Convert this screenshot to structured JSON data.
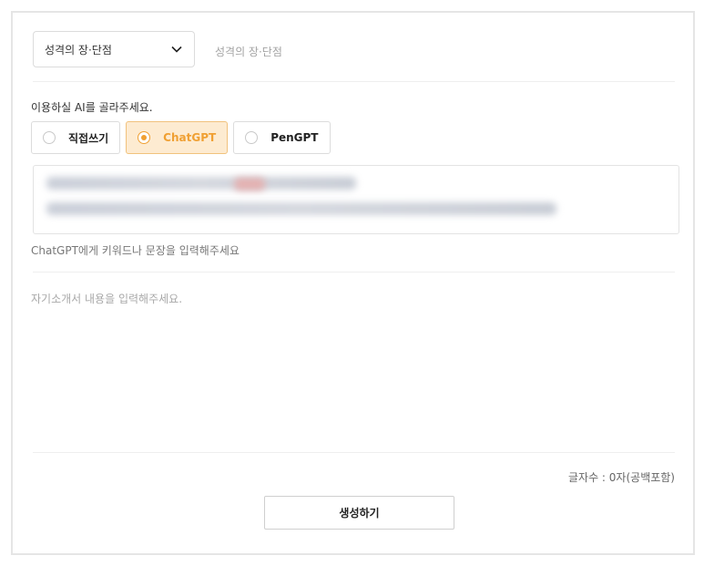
{
  "topic": {
    "select_value": "성격의 장·단점",
    "hint": "성격의 장·단점",
    "chevron_icon": "chevron-down-icon"
  },
  "ai": {
    "label": "이용하실 AI를 골라주세요.",
    "options": [
      {
        "label": "직접쓰기",
        "selected": false
      },
      {
        "label": "ChatGPT",
        "selected": true
      },
      {
        "label": "PenGPT",
        "selected": false
      }
    ],
    "accent_color": "#f0a033",
    "selected_bg": "#fdebd1"
  },
  "prompt": {
    "hint": "ChatGPT에게 키워드나 문장을 입력해주세요"
  },
  "content": {
    "placeholder": "자기소개서 내용을 입력해주세요."
  },
  "footer": {
    "char_count": "글자수 : 0자(공백포함)",
    "generate_label": "생성하기"
  }
}
